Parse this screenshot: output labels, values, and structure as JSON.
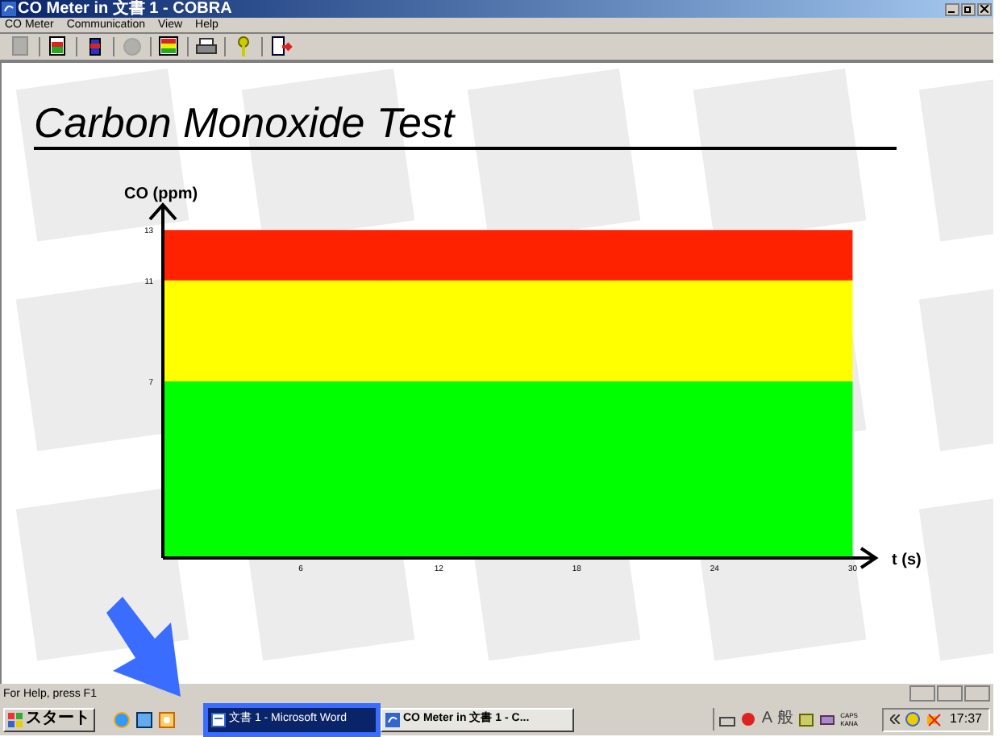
{
  "window": {
    "title": "CO Meter in 文書 1 - COBRA"
  },
  "menu": [
    {
      "label": "CO Meter"
    },
    {
      "label": "Communication"
    },
    {
      "label": "View"
    },
    {
      "label": "Help"
    }
  ],
  "toolbar": [
    {
      "kind": "document",
      "disabled": true
    },
    {
      "kind": "save",
      "disabled": false
    },
    {
      "kind": "battery",
      "disabled": false
    },
    {
      "kind": "disc",
      "disabled": true
    },
    {
      "kind": "chart",
      "disabled": false
    },
    {
      "kind": "printer",
      "disabled": false
    },
    {
      "kind": "help",
      "disabled": false
    },
    {
      "kind": "exit",
      "disabled": false
    }
  ],
  "heading": "Carbon Monoxide Test",
  "chart_data": {
    "type": "area",
    "stacked": true,
    "ylabel": "CO (ppm)",
    "xlabel": "t (s)",
    "x": [
      0,
      30
    ],
    "xlim": [
      0,
      31
    ],
    "ylim": [
      0,
      14
    ],
    "xticks": [
      6,
      12,
      18,
      24,
      30
    ],
    "yticks": [
      7,
      11,
      13
    ],
    "series": [
      {
        "color": "#00ff00",
        "values": [
          7,
          7
        ]
      },
      {
        "color": "#ffff00",
        "values": [
          4,
          4
        ]
      },
      {
        "color": "#ff2200",
        "values": [
          2,
          2
        ]
      }
    ]
  },
  "status_bar": {
    "text": "For Help, press F1"
  },
  "taskbar": {
    "start": "スタート",
    "tasks": [
      {
        "label": "文書 1 - Microsoft Word",
        "selected": true,
        "kind": "word"
      },
      {
        "label": "CO Meter in 文書 1 - C...",
        "selected": false,
        "kind": "app"
      }
    ],
    "ime": [
      "A",
      "般"
    ],
    "caps": "CAPS",
    "kana": "KANA",
    "clock": "17:37"
  }
}
